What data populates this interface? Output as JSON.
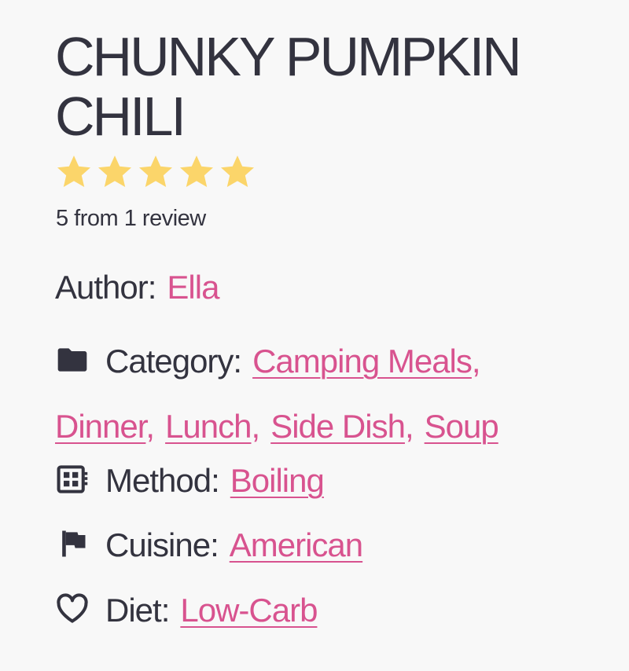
{
  "recipe": {
    "title": "CHUNKY PUMPKIN CHILI",
    "rating": {
      "value": 5,
      "max": 5,
      "star_color": "#fbd56a",
      "text": "5 from 1 review"
    }
  },
  "meta": {
    "author": {
      "label": "Author:",
      "value": "Ella"
    },
    "category": {
      "icon": "folder-icon",
      "label": "Category:",
      "values": [
        "Camping Meals",
        "Dinner",
        "Lunch",
        "Side Dish",
        "Soup"
      ]
    },
    "method": {
      "icon": "stove-icon",
      "label": "Method:",
      "value": "Boiling"
    },
    "cuisine": {
      "icon": "flag-icon",
      "label": "Cuisine:",
      "value": "American"
    },
    "diet": {
      "icon": "heart-icon",
      "label": "Diet:",
      "value": "Low-Carb"
    }
  },
  "colors": {
    "text": "#33333f",
    "link": "#d8538f",
    "background": "#f8f8f8"
  }
}
